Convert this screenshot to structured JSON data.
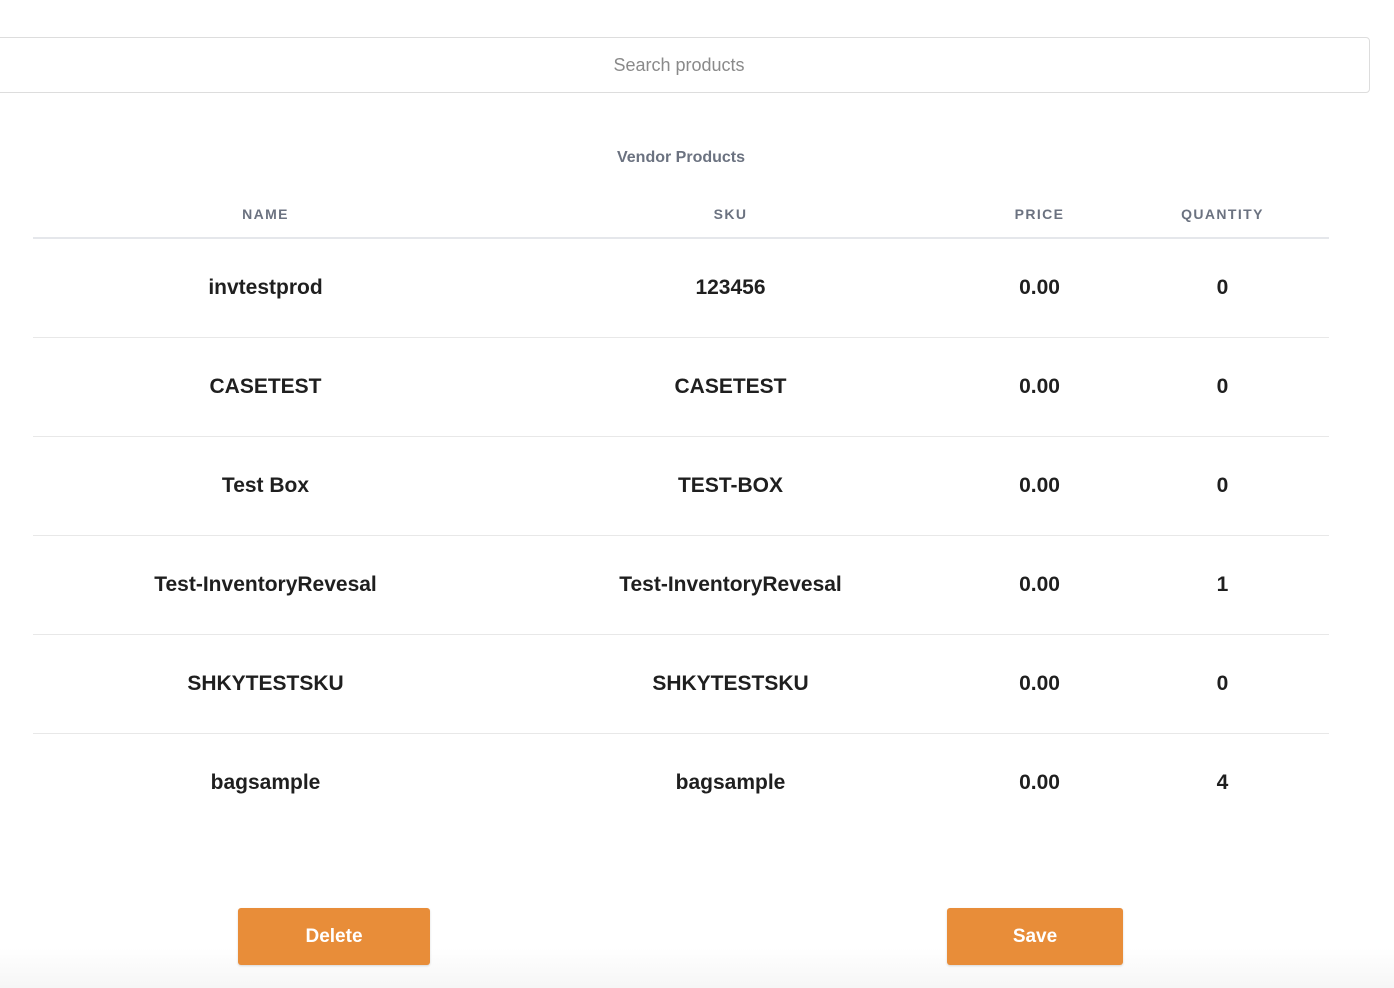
{
  "search": {
    "placeholder": "Search products",
    "value": ""
  },
  "vendor_products": {
    "title": "Vendor Products",
    "columns": {
      "name": "NAME",
      "sku": "SKU",
      "price": "PRICE",
      "quantity": "QUANTITY"
    },
    "rows": [
      {
        "name": "invtestprod",
        "sku": "123456",
        "price": "0.00",
        "quantity": "0"
      },
      {
        "name": "CASETEST",
        "sku": "CASETEST",
        "price": "0.00",
        "quantity": "0"
      },
      {
        "name": "Test Box",
        "sku": "TEST-BOX",
        "price": "0.00",
        "quantity": "0"
      },
      {
        "name": "Test-InventoryRevesal",
        "sku": "Test-InventoryRevesal",
        "price": "0.00",
        "quantity": "1"
      },
      {
        "name": "SHKYTESTSKU",
        "sku": "SHKYTESTSKU",
        "price": "0.00",
        "quantity": "0"
      },
      {
        "name": "bagsample",
        "sku": "bagsample",
        "price": "0.00",
        "quantity": "4"
      }
    ]
  },
  "actions": {
    "delete_label": "Delete",
    "save_label": "Save"
  },
  "colors": {
    "accent": "#e88d39",
    "header_text": "#6b7280",
    "body_text": "#1f1f1f"
  }
}
